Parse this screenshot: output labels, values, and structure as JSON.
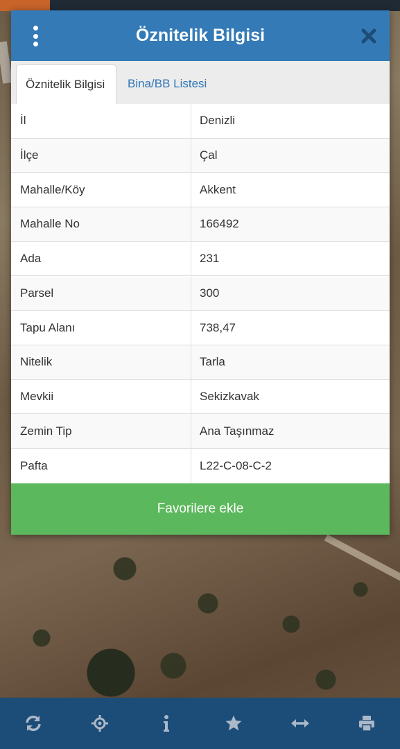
{
  "dialog": {
    "title": "Öznitelik Bilgisi",
    "tabs": [
      {
        "label": "Öznitelik Bilgisi",
        "active": true
      },
      {
        "label": "Bina/BB Listesi",
        "active": false
      }
    ],
    "rows": [
      {
        "key": "İl",
        "value": "Denizli"
      },
      {
        "key": "İlçe",
        "value": "Çal"
      },
      {
        "key": "Mahalle/Köy",
        "value": "Akkent"
      },
      {
        "key": "Mahalle No",
        "value": "166492"
      },
      {
        "key": "Ada",
        "value": "231"
      },
      {
        "key": "Parsel",
        "value": "300"
      },
      {
        "key": "Tapu Alanı",
        "value": "738,47"
      },
      {
        "key": "Nitelik",
        "value": "Tarla"
      },
      {
        "key": "Mevkii",
        "value": "Sekizkavak"
      },
      {
        "key": "Zemin Tip",
        "value": "Ana Taşınmaz"
      },
      {
        "key": "Pafta",
        "value": "L22-C-08-C-2"
      }
    ],
    "favorite_button": "Favorilere ekle",
    "menu_icon": "kebab-menu-icon",
    "close_icon": "close-icon"
  },
  "bottom_bar": {
    "icons": [
      "refresh-icon",
      "locate-icon",
      "info-icon",
      "star-icon",
      "measure-icon",
      "print-icon"
    ]
  },
  "colors": {
    "header": "#337ab7",
    "tab_link": "#2f76b8",
    "favorite_button": "#5cb85c",
    "bottom_bar": "#1c4c78",
    "bottom_icons": "#aab8c8"
  }
}
